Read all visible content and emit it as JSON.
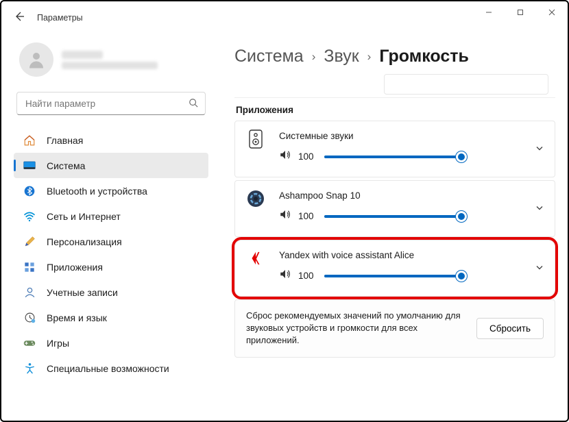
{
  "window": {
    "title": "Параметры"
  },
  "user": {
    "name_hidden": true,
    "email_hidden": true
  },
  "search": {
    "placeholder": "Найти параметр"
  },
  "sidebar": {
    "items": [
      {
        "label": "Главная",
        "icon": "home"
      },
      {
        "label": "Система",
        "icon": "system",
        "active": true
      },
      {
        "label": "Bluetooth и устройства",
        "icon": "bluetooth"
      },
      {
        "label": "Сеть и Интернет",
        "icon": "wifi"
      },
      {
        "label": "Персонализация",
        "icon": "brush"
      },
      {
        "label": "Приложения",
        "icon": "apps"
      },
      {
        "label": "Учетные записи",
        "icon": "account"
      },
      {
        "label": "Время и язык",
        "icon": "clock"
      },
      {
        "label": "Игры",
        "icon": "gamepad"
      },
      {
        "label": "Специальные возможности",
        "icon": "accessibility"
      }
    ]
  },
  "breadcrumb": {
    "items": [
      "Система",
      "Звук",
      "Громкость"
    ]
  },
  "section": {
    "apps_label": "Приложения"
  },
  "apps": [
    {
      "title": "Системные звуки",
      "volume": 100,
      "icon": "speaker-device"
    },
    {
      "title": "Ashampoo Snap 10",
      "volume": 100,
      "icon": "ashampoo"
    },
    {
      "title": "Yandex with voice assistant Alice",
      "volume": 100,
      "icon": "yandex",
      "highlight": true
    }
  ],
  "reset": {
    "text": "Сброс рекомендуемых значений по умолчанию для звуковых устройств и громкости для всех приложений.",
    "button": "Сбросить"
  },
  "colors": {
    "accent": "#0067c0",
    "highlight": "#e30000"
  }
}
